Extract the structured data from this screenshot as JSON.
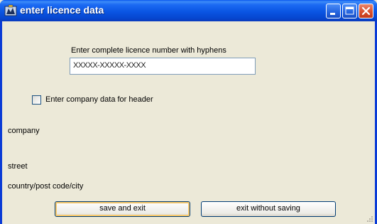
{
  "window": {
    "title": "enter licence data",
    "icon": "app-icon",
    "controls": [
      "minimize-icon",
      "maximize-icon",
      "close-icon"
    ]
  },
  "licence": {
    "label": "Enter complete licence number with hyphens",
    "value": "XXXXX-XXXXX-XXXX"
  },
  "company_checkbox": {
    "label": "Enter company data for header",
    "checked": false
  },
  "fields": {
    "company": "company",
    "street": "street",
    "country": "country/post code/city"
  },
  "buttons": {
    "save": "save and exit",
    "exit": "exit without saving"
  },
  "colors": {
    "titlebar": "#0a55e3",
    "client_bg": "#ece9d8",
    "close_button": "#d8502f"
  }
}
